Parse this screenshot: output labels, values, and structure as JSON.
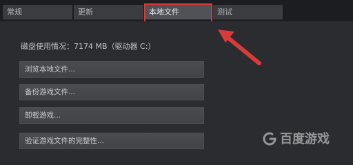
{
  "tabs": [
    {
      "label": "常规"
    },
    {
      "label": "更新"
    },
    {
      "label": "本地文件"
    },
    {
      "label": "测试"
    }
  ],
  "disk_usage": "磁盘使用情况：7174 MB（驱动器 C:）",
  "buttons": [
    {
      "label": "浏览本地文件..."
    },
    {
      "label": "备份游戏文件..."
    },
    {
      "label": "卸载游戏..."
    },
    {
      "label": "验证游戏文件的完整性..."
    }
  ],
  "watermark": "百度游戏",
  "colors": {
    "highlight": "#d93a3a",
    "arrow": "#d93a3a"
  }
}
